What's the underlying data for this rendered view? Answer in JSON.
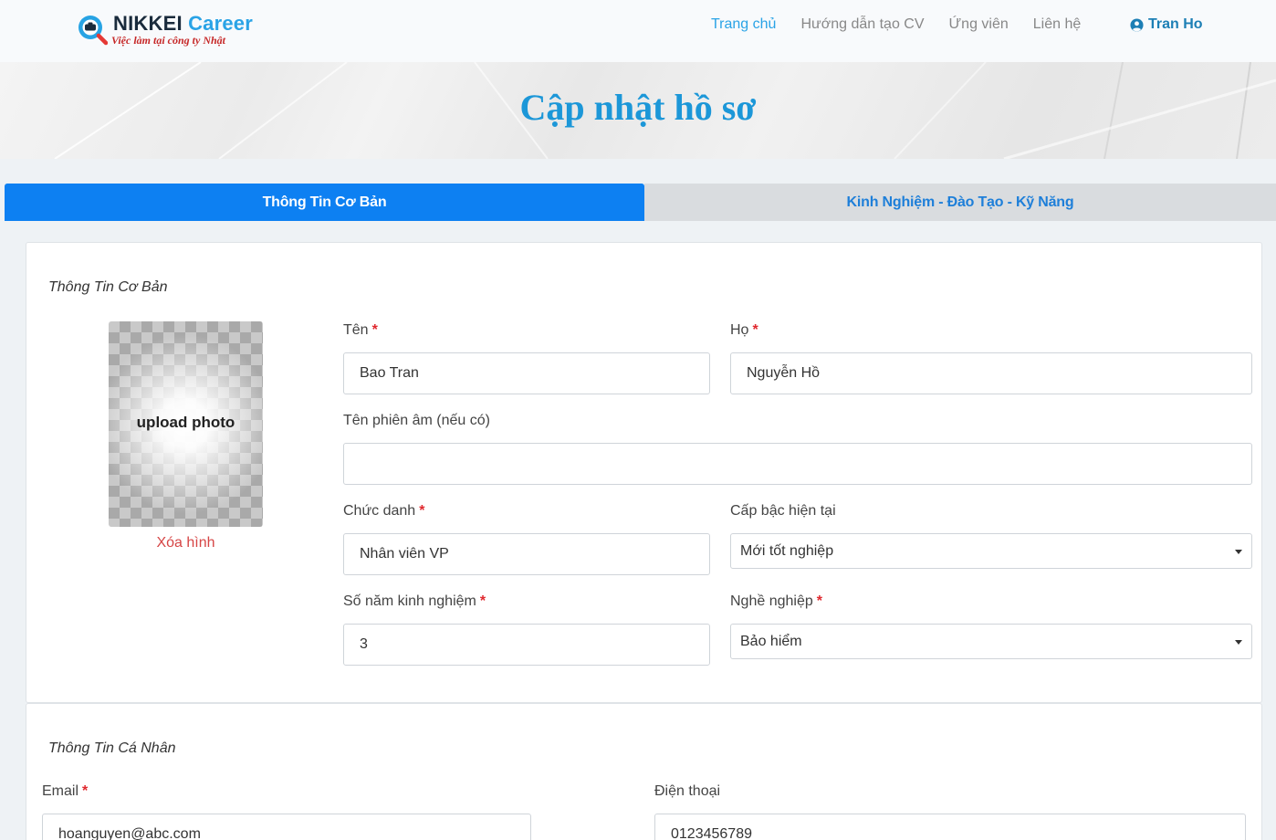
{
  "brand": {
    "name_dark": "NIKKEI",
    "name_light": "Career",
    "tagline": "Việc làm tại công ty Nhật"
  },
  "nav": {
    "items": [
      {
        "label": "Trang chủ",
        "active": true
      },
      {
        "label": "Hướng dẫn tạo CV",
        "active": false
      },
      {
        "label": "Ứng viên",
        "active": false
      },
      {
        "label": "Liên hệ",
        "active": false
      }
    ],
    "user_name": "Tran Ho",
    "user_icon": "user-circle-icon"
  },
  "banner": {
    "title": "Cập nhật hồ sơ"
  },
  "tabs": [
    {
      "label": "Thông Tin Cơ Bản",
      "active": true
    },
    {
      "label": "Kinh Nghiệm - Đào Tạo - Kỹ Năng",
      "active": false
    }
  ],
  "basic": {
    "section_title": "Thông Tin Cơ Bản",
    "photo": {
      "label": "upload photo",
      "remove_label": "Xóa hình"
    },
    "first_name": {
      "label": "Tên",
      "required": "*",
      "value": "Bao Tran"
    },
    "last_name": {
      "label": "Họ",
      "required": "*",
      "value": "Nguyễn Hồ"
    },
    "phonetic_name": {
      "label": "Tên phiên âm (nếu có)",
      "value": ""
    },
    "job_title": {
      "label": "Chức danh",
      "required": "*",
      "value": "Nhân viên VP"
    },
    "current_level": {
      "label": "Cấp bậc hiện tại",
      "value": "Mới tốt nghiệp"
    },
    "years_experience": {
      "label": "Số năm kinh nghiệm",
      "required": "*",
      "value": "3"
    },
    "occupation": {
      "label": "Nghề nghiệp",
      "required": "*",
      "value": "Bảo hiểm"
    }
  },
  "personal": {
    "section_title": "Thông Tin Cá Nhân",
    "email": {
      "label": "Email",
      "required": "*",
      "value": "hoanguyen@abc.com"
    },
    "phone": {
      "label": "Điện thoại",
      "value": "0123456789"
    }
  },
  "colors": {
    "brand_blue": "#2aa3e6",
    "tab_active": "#0d80f2",
    "required_red": "#e0282e",
    "remove_red": "#d64545"
  }
}
